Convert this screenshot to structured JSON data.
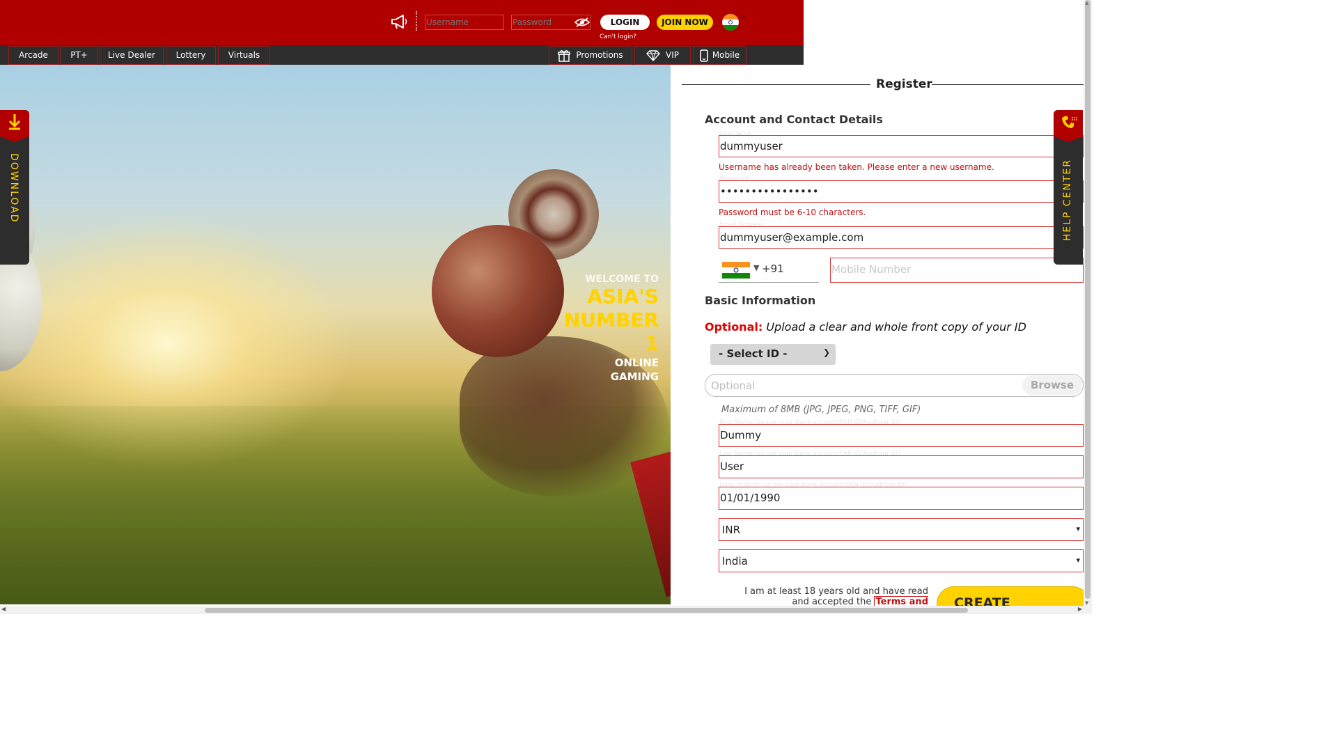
{
  "header": {
    "username_placeholder": "Username",
    "password_placeholder": "Password",
    "login_label": "LOGIN",
    "join_label": "JOIN NOW",
    "cant_login": "Can't login?"
  },
  "nav": {
    "left": [
      "Arcade",
      "PT+",
      "Live Dealer",
      "Lottery",
      "Virtuals"
    ],
    "right": [
      {
        "label": "Promotions",
        "icon": "gift-icon"
      },
      {
        "label": "VIP",
        "icon": "diamond-icon"
      },
      {
        "label": "Mobile",
        "icon": "mobile-icon"
      }
    ]
  },
  "hero": {
    "welcome_to": "WELCOME TO",
    "asias": "ASIA'S",
    "number": "NUMBER",
    "one": "1",
    "online": "ONLINE",
    "gaming": "GAMING"
  },
  "side_tabs": {
    "download": "DOWNLOAD",
    "help_center": "HELP CENTER"
  },
  "register": {
    "title": "Register",
    "section_account": "Account and Contact Details",
    "username_label": "Username",
    "username_value": "dummyuser",
    "username_error": "Username has already been taken. Please enter a new username.",
    "password_label": "Password",
    "password_value": "••••••••••••••••",
    "password_error": "Password must be 6-10 characters.",
    "email_label": "Email Address",
    "email_value": "dummyuser@example.com",
    "dial_code": "+91",
    "mobile_placeholder": "Mobile Number",
    "section_basic": "Basic Information",
    "optional_label": "Optional:",
    "optional_text": "Upload a clear and whole front copy of your ID",
    "select_id": "- Select ID -",
    "upload_placeholder": "Optional",
    "browse_label": "Browse",
    "max_size": "Maximum of 8MB (JPG, JPEG, PNG, TIFF, GIF)",
    "first_name_label": "First Name (as per your Bank account/PAN ID/Aadhaar ID)",
    "first_name_value": "Dummy",
    "last_name_label": "Last Name (as per your Bank account/PAN ID/Aadhaar ID)",
    "last_name_value": "User",
    "dob_label": "Date of Birth (as per your Bank account/PAN ID/Aadhaar ID)",
    "dob_value": "01/01/1990",
    "currency_value": "INR",
    "country_value": "India",
    "terms_prefix": "I am at least 18 years old and have read and accepted the",
    "terms_link": "Terms and Conditions",
    "terms_suffix": ".",
    "create_label": "CREATE ACCOUNT"
  },
  "colors": {
    "brand_red": "#b00000",
    "accent_yellow": "#ffd200",
    "error_red": "#c01010"
  }
}
